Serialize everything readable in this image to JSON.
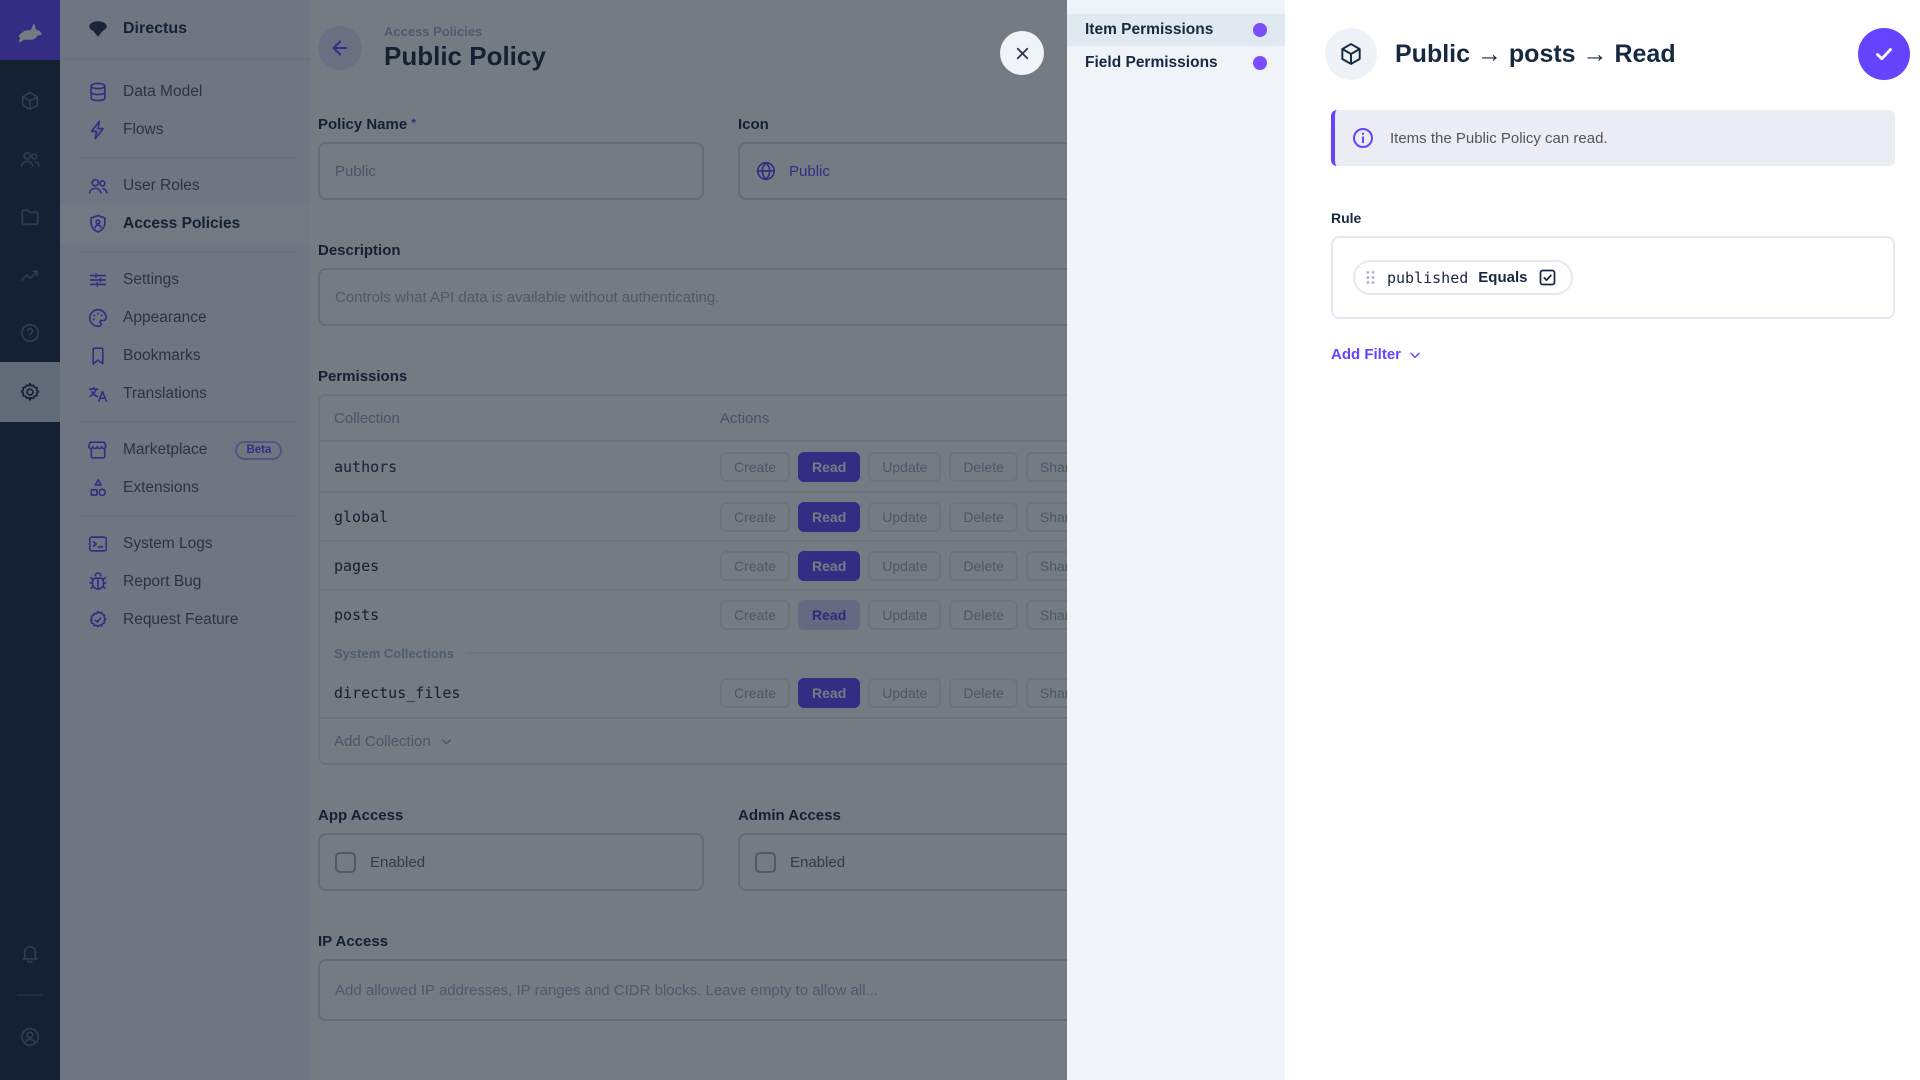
{
  "colors": {
    "accent_purple": "#6644ff",
    "navy": "#172940",
    "sidebar_bg": "#f0f4f9"
  },
  "project": {
    "name": "Directus"
  },
  "module_bar": {
    "modules": [
      "content-module",
      "users-module",
      "files-module",
      "insights-module",
      "docs-module",
      "settings-module"
    ],
    "active_module": "settings-module",
    "bottom": [
      "notifications",
      "account"
    ]
  },
  "sidebar": {
    "items": [
      {
        "label": "Data Model",
        "icon": "database"
      },
      {
        "label": "Flows",
        "icon": "bolt"
      },
      {
        "divider": true
      },
      {
        "label": "User Roles",
        "icon": "users"
      },
      {
        "label": "Access Policies",
        "icon": "shield",
        "active": true
      },
      {
        "divider": true
      },
      {
        "label": "Settings",
        "icon": "tune"
      },
      {
        "label": "Appearance",
        "icon": "palette"
      },
      {
        "label": "Bookmarks",
        "icon": "bookmark"
      },
      {
        "label": "Translations",
        "icon": "translate"
      },
      {
        "divider": true
      },
      {
        "label": "Marketplace",
        "icon": "store",
        "badge": "Beta"
      },
      {
        "label": "Extensions",
        "icon": "shapes"
      },
      {
        "divider": true
      },
      {
        "label": "System Logs",
        "icon": "terminal"
      },
      {
        "label": "Report Bug",
        "icon": "bug"
      },
      {
        "label": "Request Feature",
        "icon": "seal"
      }
    ]
  },
  "content": {
    "breadcrumb": "Access Policies",
    "title": "Public Policy",
    "policy_name": {
      "label": "Policy Name",
      "required_mark": "*",
      "value": "Public"
    },
    "icon_field": {
      "label": "Icon",
      "value": "Public"
    },
    "description": {
      "label": "Description",
      "placeholder": "Controls what API data is available without authenticating."
    },
    "permissions": {
      "label": "Permissions",
      "columns": [
        "Collection",
        "Actions"
      ],
      "actions": [
        "Create",
        "Read",
        "Update",
        "Delete",
        "Share"
      ],
      "rows": [
        {
          "collection": "authors",
          "read": "solid"
        },
        {
          "collection": "global",
          "read": "solid"
        },
        {
          "collection": "pages",
          "read": "solid"
        },
        {
          "collection": "posts",
          "read": "light"
        },
        {
          "divider_label": "System Collections"
        },
        {
          "collection": "directus_files",
          "read": "solid"
        }
      ],
      "add_collection": "Add Collection"
    },
    "app_access": {
      "label": "App Access",
      "checkbox_label": "Enabled",
      "checked": false
    },
    "admin_access": {
      "label": "Admin Access",
      "checkbox_label": "Enabled",
      "checked": false
    },
    "ip_access": {
      "label": "IP Access",
      "placeholder": "Add allowed IP addresses, IP ranges and CIDR blocks. Leave empty to allow all..."
    }
  },
  "drawer": {
    "nav": [
      {
        "label": "Item Permissions",
        "active": true,
        "dot": true
      },
      {
        "label": "Field Permissions",
        "active": false,
        "dot": true
      }
    ],
    "title": "Public → posts → Read",
    "header_icon": "box",
    "save_icon": "check",
    "notice": {
      "icon": "info",
      "text": "Items the Public Policy can read."
    },
    "rule": {
      "label": "Rule",
      "filter": {
        "field": "published",
        "operator": "Equals",
        "value_checked": true
      },
      "add_filter_label": "Add Filter"
    }
  }
}
